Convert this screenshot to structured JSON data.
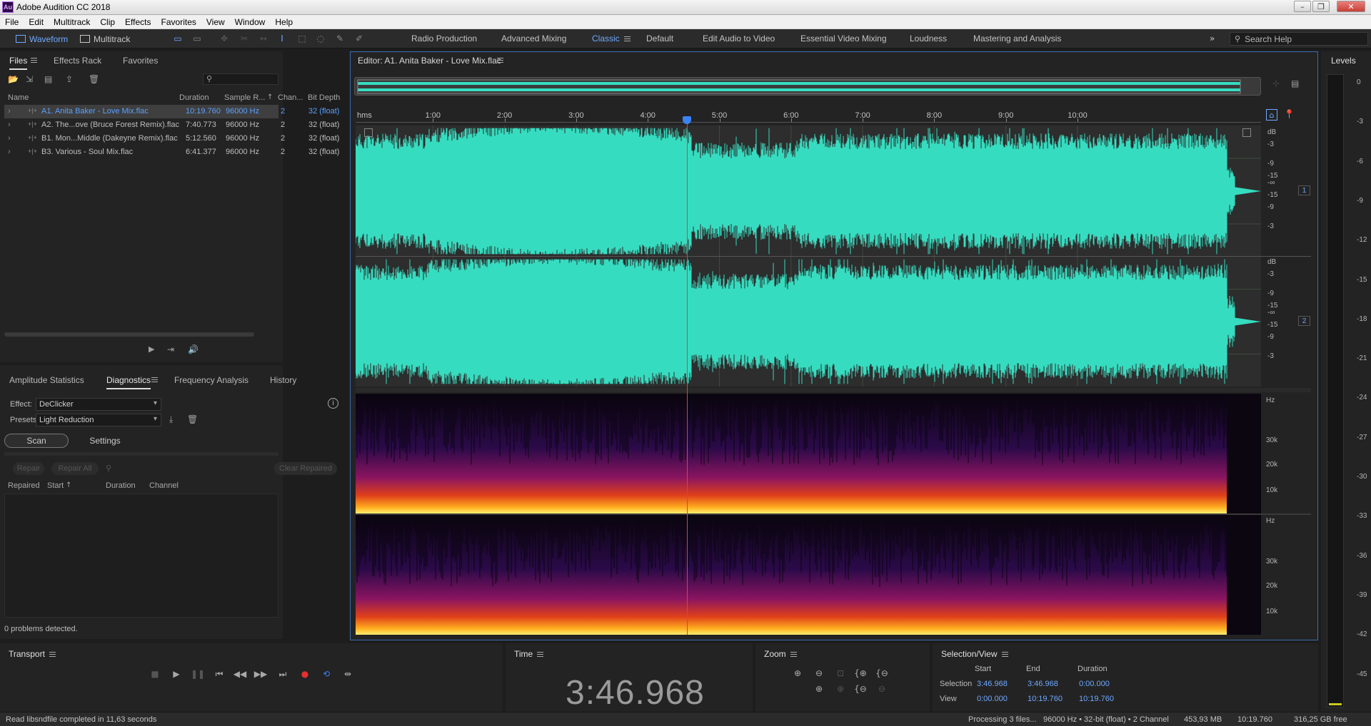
{
  "window": {
    "title": "Adobe Audition CC 2018",
    "logo_text": "Au"
  },
  "menu": [
    "File",
    "Edit",
    "Multitrack",
    "Clip",
    "Effects",
    "Favorites",
    "View",
    "Window",
    "Help"
  ],
  "toolbar": {
    "waveform_label": "Waveform",
    "multitrack_label": "Multitrack",
    "workspaces": [
      "Radio Production",
      "Advanced Mixing",
      "Classic",
      "Default",
      "Edit Audio to Video",
      "Essential Video Mixing",
      "Loudness",
      "Mastering and Analysis"
    ],
    "active_workspace": "Classic",
    "search_placeholder": "Search Help"
  },
  "files_panel": {
    "tabs": [
      "Files",
      "Effects Rack",
      "Favorites"
    ],
    "columns": [
      "Name",
      "Duration",
      "Sample R...",
      "Chan...",
      "Bit Depth"
    ],
    "rows": [
      {
        "name": "A1. Anita Baker - Love Mix.flac",
        "duration": "10:19.760",
        "sample_rate": "96000 Hz",
        "channels": "2",
        "bit_depth": "32 (float)"
      },
      {
        "name": "A2. The...ove (Bruce Forest Remix).flac",
        "duration": "7:40.773",
        "sample_rate": "96000 Hz",
        "channels": "2",
        "bit_depth": "32 (float)"
      },
      {
        "name": "B1. Mon...Middle (Dakeyne Remix).flac",
        "duration": "5:12.560",
        "sample_rate": "96000 Hz",
        "channels": "2",
        "bit_depth": "32 (float)"
      },
      {
        "name": "B3. Various - Soul Mix.flac",
        "duration": "6:41.377",
        "sample_rate": "96000 Hz",
        "channels": "2",
        "bit_depth": "32 (float)"
      }
    ]
  },
  "diagnostics_panel": {
    "tabs": [
      "Amplitude Statistics",
      "Diagnostics",
      "Frequency Analysis",
      "History"
    ],
    "effect_label": "Effect:",
    "effect_value": "DeClicker",
    "presets_label": "Presets:",
    "presets_value": "Light Reduction",
    "scan_label": "Scan",
    "settings_label": "Settings",
    "repair_label": "Repair",
    "repair_all_label": "Repair All",
    "clear_repaired_label": "Clear Repaired",
    "columns": [
      "Repaired",
      "Start",
      "Duration",
      "Channel"
    ],
    "status": "0 problems detected."
  },
  "editor": {
    "title": "Editor: A1. Anita Baker - Love Mix.flac",
    "ruler_unit": "hms",
    "ruler_ticks": [
      "1:00",
      "2:00",
      "3:00",
      "4:00",
      "5:00",
      "6:00",
      "7:00",
      "8:00",
      "9:00",
      "10:00"
    ],
    "db_labels": [
      "dB",
      "-3",
      "-9",
      "-15",
      "-∞",
      "-15",
      "-9",
      "-3"
    ],
    "channels": [
      "1",
      "2"
    ],
    "hz_label": "Hz",
    "hz_ticks": [
      "30k",
      "20k",
      "10k"
    ],
    "colors": {
      "waveform": "#36dcc0",
      "playhead": "#e04040",
      "accent": "#6ea9ff"
    }
  },
  "levels": {
    "title": "Levels",
    "scale": [
      "0",
      "-3",
      "-6",
      "-9",
      "-12",
      "-15",
      "-18",
      "-21",
      "-24",
      "-27",
      "-30",
      "-33",
      "-36",
      "-39",
      "-42",
      "-45"
    ]
  },
  "transport": {
    "title": "Transport"
  },
  "time": {
    "title": "Time",
    "value": "3:46.968"
  },
  "zoom": {
    "title": "Zoom"
  },
  "selection_view": {
    "title": "Selection/View",
    "headers": [
      "Start",
      "End",
      "Duration"
    ],
    "selection_label": "Selection",
    "view_label": "View",
    "selection": [
      "3:46.968",
      "3:46.968",
      "0:00.000"
    ],
    "view": [
      "0:00.000",
      "10:19.760",
      "10:19.760"
    ]
  },
  "statusbar": {
    "message": "Read libsndfile completed in 11,63 seconds",
    "processing": "Processing 3 files...",
    "format": "96000 Hz • 32-bit (float) • 2 Channel",
    "size": "453,93 MB",
    "duration": "10:19.760",
    "free": "316,25 GB free"
  }
}
